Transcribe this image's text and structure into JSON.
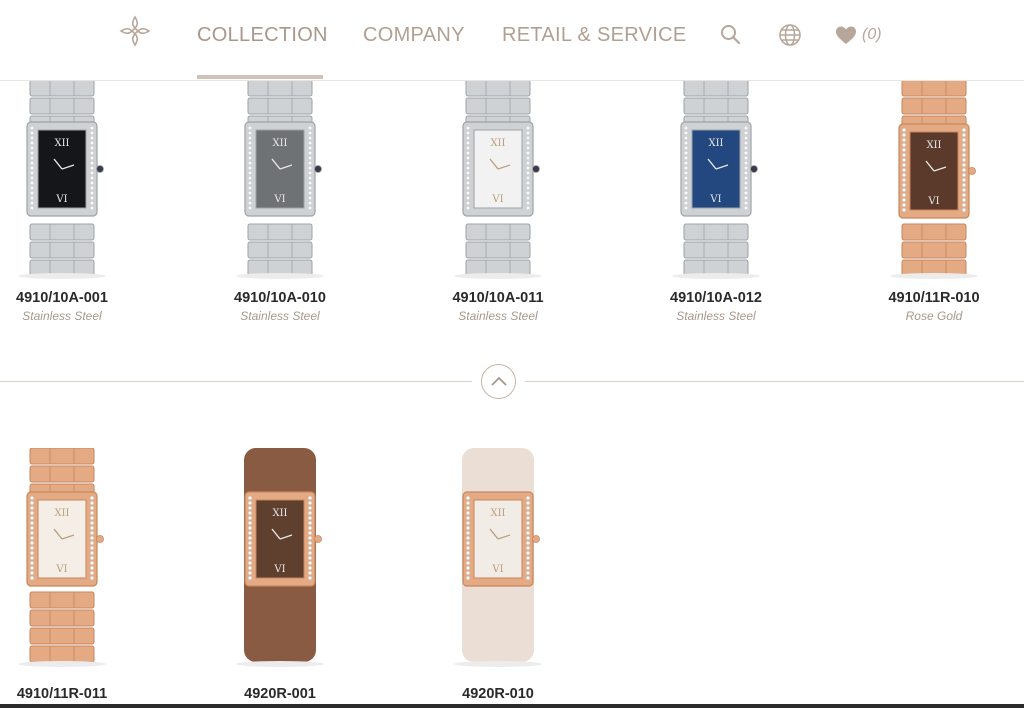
{
  "nav": {
    "items": [
      "COLLECTION",
      "COMPANY",
      "RETAIL & SERVICE"
    ],
    "favorites_count": "(0)"
  },
  "colors": {
    "accent": "#b19f92",
    "underline": "#d0c2b6",
    "steel": "#cfd2d5",
    "rose_gold": "#e4aa84"
  },
  "icons": [
    "brand-cross-logo",
    "search-icon",
    "globe-icon",
    "heart-icon",
    "chevron-up-icon"
  ],
  "products": [
    {
      "ref": "4910/10A-001",
      "material": "Stainless Steel",
      "metal": "steel",
      "dial": "#15161a",
      "strap": "bracelet"
    },
    {
      "ref": "4910/10A-010",
      "material": "Stainless Steel",
      "metal": "steel",
      "dial": "#6f7275",
      "strap": "bracelet"
    },
    {
      "ref": "4910/10A-011",
      "material": "Stainless Steel",
      "metal": "steel",
      "dial": "#f2f2f2",
      "strap": "bracelet"
    },
    {
      "ref": "4910/10A-012",
      "material": "Stainless Steel",
      "metal": "steel",
      "dial": "#23477f",
      "strap": "bracelet"
    },
    {
      "ref": "4910/11R-010",
      "material": "Rose Gold",
      "metal": "rose",
      "dial": "#5b3a2c",
      "strap": "bracelet"
    },
    {
      "ref": "4910/11R-011",
      "material": "",
      "metal": "rose",
      "dial": "#f4eee7",
      "strap": "bracelet"
    },
    {
      "ref": "4920R-001",
      "material": "",
      "metal": "rose",
      "dial": "#5f3f2e",
      "strap": "#8a5b43"
    },
    {
      "ref": "4920R-010",
      "material": "",
      "metal": "rose",
      "dial": "#f2ece6",
      "strap": "#ebded4"
    }
  ]
}
